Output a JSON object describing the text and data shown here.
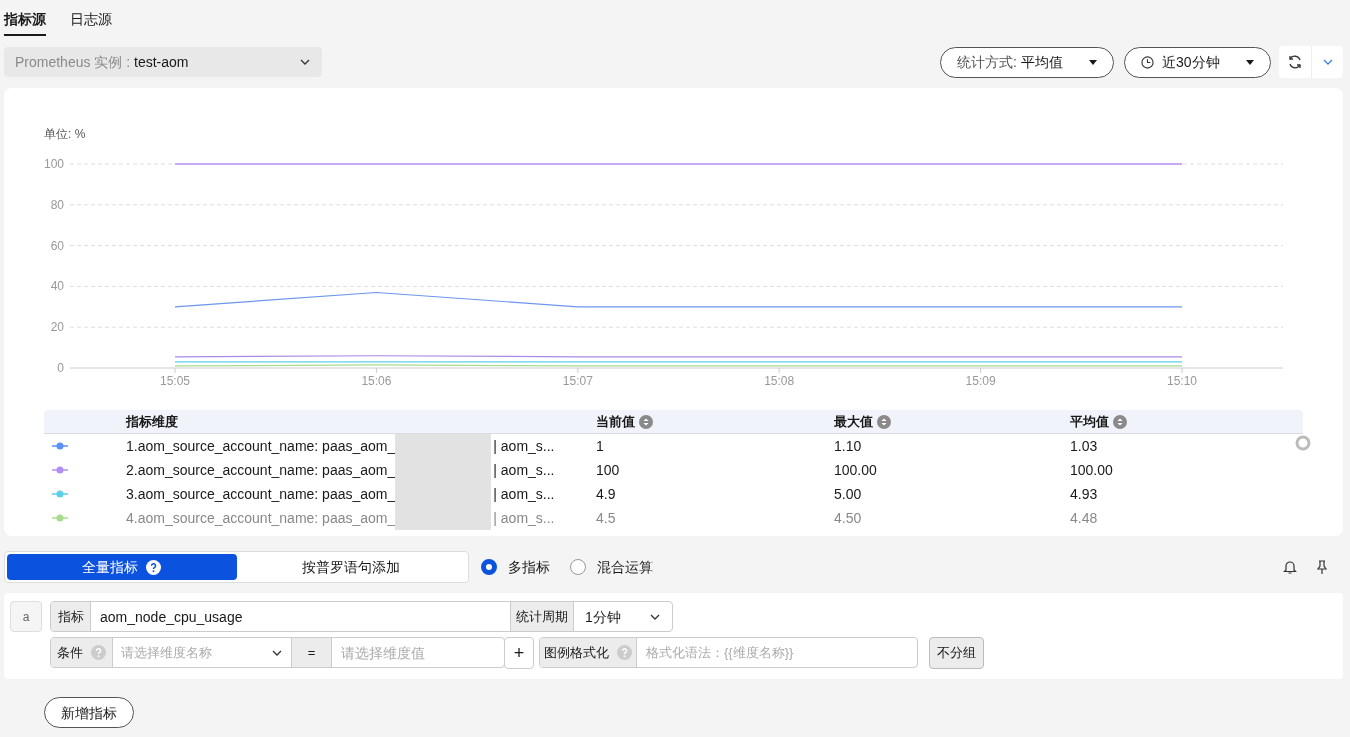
{
  "source_tabs": [
    {
      "label": "指标源",
      "selected": true
    },
    {
      "label": "日志源",
      "selected": false
    }
  ],
  "instance_select": {
    "label": "Prometheus 实例 :",
    "value": "test-aom"
  },
  "stat_select": {
    "label": "统计方式:",
    "value": "平均值"
  },
  "time_select": {
    "value": "近30分钟"
  },
  "chart": {
    "unit": "单位: %",
    "chart_data": {
      "type": "line",
      "grid": true,
      "categories": [
        "15:05",
        "15:06",
        "15:07",
        "15:08",
        "15:09",
        "15:10"
      ],
      "ylim": [
        0,
        100
      ],
      "yticks": [
        0,
        20,
        40,
        60,
        80,
        100
      ],
      "series": [
        {
          "color": "#c9a8f5",
          "values": [
            100,
            100,
            100,
            100,
            100,
            100
          ]
        },
        {
          "color": "#6e95f0",
          "values": [
            30,
            37,
            30,
            30,
            30,
            30
          ]
        },
        {
          "color": "#a98ae8",
          "values": [
            5.5,
            6,
            5.5,
            5.5,
            5.5,
            5.5
          ]
        },
        {
          "color": "#5bd0e8",
          "values": [
            3,
            3,
            3,
            3,
            3,
            3
          ]
        },
        {
          "color": "#a6dc8c",
          "values": [
            1,
            1.5,
            1,
            1,
            1,
            1
          ]
        }
      ]
    }
  },
  "legend_table": {
    "columns": [
      "指标维度",
      "当前值",
      "最大值",
      "平均值"
    ],
    "rows": [
      {
        "color": "#5b8ff9",
        "dimension_start": "1.aom_source_account_name: paas_aom_",
        "dimension_end": "| aom_s...",
        "current": "1",
        "max": "1.10",
        "avg": "1.03",
        "faded": false
      },
      {
        "color": "#b38cf5",
        "dimension_start": "2.aom_source_account_name: paas_aom_",
        "dimension_end": "| aom_s...",
        "current": "100",
        "max": "100.00",
        "avg": "100.00",
        "faded": false
      },
      {
        "color": "#5bd0e8",
        "dimension_start": "3.aom_source_account_name: paas_aom_",
        "dimension_end": "| aom_s...",
        "current": "4.9",
        "max": "5.00",
        "avg": "4.93",
        "faded": false
      },
      {
        "color": "#a6dc8c",
        "dimension_start": "4.aom_source_account_name: paas_aom_",
        "dimension_end": "| aom_s...",
        "current": "4.5",
        "max": "4.50",
        "avg": "4.48",
        "faded": true
      }
    ]
  },
  "mode_tabs": [
    {
      "label": "全量指标",
      "selected": true,
      "help": true
    },
    {
      "label": "按普罗语句添加",
      "selected": false,
      "help": false
    }
  ],
  "radios": [
    {
      "label": "多指标",
      "selected": true
    },
    {
      "label": "混合运算",
      "selected": false
    }
  ],
  "query": {
    "letter": "a",
    "metric_label": "指标",
    "metric_value": "aom_node_cpu_usage",
    "period_label": "统计周期",
    "period_value": "1分钟",
    "condition_label": "条件",
    "condition_placeholder": "请选择维度名称",
    "operator": "=",
    "value_placeholder": "请选择维度值",
    "plus": "+",
    "legend_label": "图例格式化",
    "legend_placeholder": "格式化语法：{{维度名称}}",
    "group_button": "不分组"
  },
  "add_button": "新增指标"
}
